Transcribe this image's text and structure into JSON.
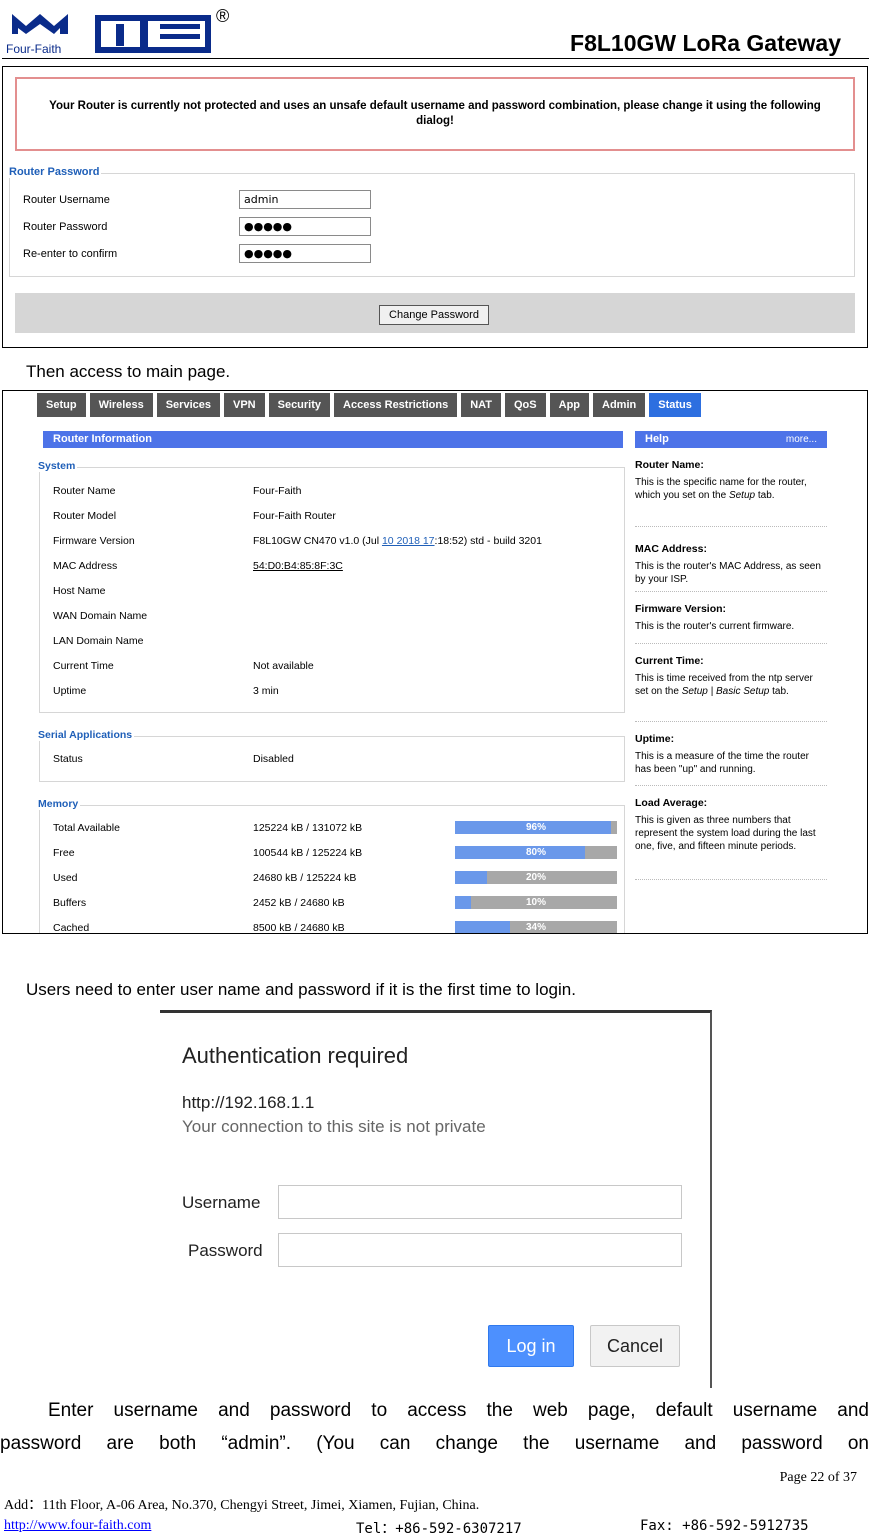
{
  "header": {
    "logo_text": "Four-Faith",
    "registered": "®",
    "doc_title": "F8L10GW LoRa Gateway"
  },
  "password_page": {
    "warning": "Your Router is currently not protected and uses an unsafe default username and password combination, please change it using the following dialog!",
    "section": "Router Password",
    "username_label": "Router Username",
    "username_value": "admin",
    "password_label": "Router Password",
    "password_value": "●●●●●",
    "confirm_label": "Re-enter to confirm",
    "confirm_value": "●●●●●",
    "button": "Change Password"
  },
  "text1": "Then access to main page.",
  "status_page": {
    "tabs": [
      "Setup",
      "Wireless",
      "Services",
      "VPN",
      "Security",
      "Access Restrictions",
      "NAT",
      "QoS",
      "App",
      "Admin",
      "Status"
    ],
    "active_tab": "Status",
    "router_info_title": "Router Information",
    "help_title": "Help",
    "help_more": "more...",
    "system_legend": "System",
    "system_rows": [
      {
        "label": "Router Name",
        "value": "Four-Faith"
      },
      {
        "label": "Router Model",
        "value": "Four-Faith Router"
      },
      {
        "label": "Firmware Version",
        "value_pre": "F8L10GW CN470 v1.0 (Jul ",
        "value_link": "10 2018 17",
        "value_post": ":18:52) std - build 3201"
      },
      {
        "label": "MAC Address",
        "value": "54:D0:B4:85:8F:3C"
      },
      {
        "label": "Host Name",
        "value": ""
      },
      {
        "label": "WAN Domain Name",
        "value": ""
      },
      {
        "label": "LAN Domain Name",
        "value": ""
      },
      {
        "label": "Current Time",
        "value": "Not available"
      },
      {
        "label": "Uptime",
        "value": "3 min"
      }
    ],
    "serial_legend": "Serial Applications",
    "serial_rows": [
      {
        "label": "Status",
        "value": "Disabled"
      }
    ],
    "memory_legend": "Memory",
    "memory_rows": [
      {
        "label": "Total Available",
        "value": "125224 kB / 131072 kB",
        "pct_label": "96%",
        "pct": 96
      },
      {
        "label": "Free",
        "value": "100544 kB / 125224 kB",
        "pct_label": "80%",
        "pct": 80
      },
      {
        "label": "Used",
        "value": "24680 kB / 125224 kB",
        "pct_label": "20%",
        "pct": 20
      },
      {
        "label": "Buffers",
        "value": "2452 kB / 24680 kB",
        "pct_label": "10%",
        "pct": 10
      },
      {
        "label": "Cached",
        "value": "8500 kB / 24680 kB",
        "pct_label": "34%",
        "pct": 34
      }
    ],
    "help_items": [
      {
        "title": "Router Name:",
        "text_parts": [
          "This is the specific name for the router, which you set on the ",
          "Setup",
          " tab."
        ]
      },
      {
        "title": "MAC Address:",
        "text_parts": [
          "This is the router's MAC Address, as seen by your ISP."
        ]
      },
      {
        "title": "Firmware Version:",
        "text_parts": [
          "This is the router's current firmware."
        ]
      },
      {
        "title": "Current Time:",
        "text_parts": [
          "This is time received from the ntp server set on the ",
          "Setup | Basic Setup",
          " tab."
        ]
      },
      {
        "title": "Uptime:",
        "text_parts": [
          "This is a measure of the time the router has been \"up\" and running."
        ]
      },
      {
        "title": "Load Average:",
        "text_parts": [
          "This is given as three numbers that represent the system load during the last one, five, and fifteen minute periods."
        ]
      }
    ]
  },
  "text2": "Users need to enter user name and password if it is the first time to login.",
  "auth_dialog": {
    "title": "Authentication required",
    "url": "http://192.168.1.1",
    "note": "Your connection to this site is not private",
    "username_label": "Username",
    "password_label": "Password",
    "login_button": "Log in",
    "cancel_button": "Cancel"
  },
  "text3_line1": "Enter  username  and  password  to  access  the  web  page,  default  username  and",
  "text3_line2": "password  are  both  “admin”.  (You  can  change  the  username  and  password  on",
  "footer": {
    "page": "Page  22  of  37",
    "address": "Add：11th Floor, A-06 Area, No.370, Chengyi Street, Jimei, Xiamen, Fujian, China.",
    "url": "http://www.four-faith.com",
    "tel": "Tel：+86-592-6307217",
    "fax": "Fax: +86-592-5912735"
  }
}
